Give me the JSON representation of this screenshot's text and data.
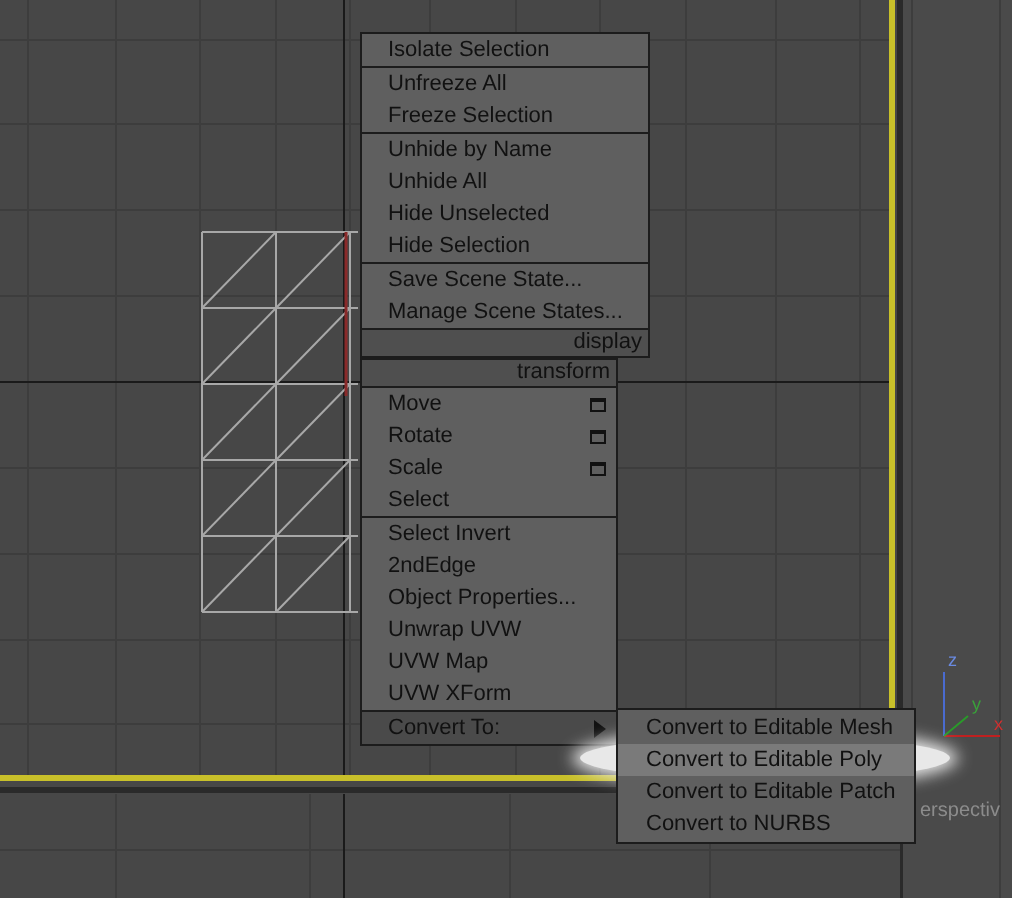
{
  "viewport": {
    "perspective_label": "erspectiv",
    "axis_labels": [
      "z",
      "y",
      "x"
    ]
  },
  "quad_menu": {
    "display": {
      "title": "display",
      "groups": [
        [
          {
            "label": "Isolate Selection",
            "selected": false,
            "options_box": false,
            "submenu": false
          }
        ],
        [
          {
            "label": "Unfreeze All",
            "selected": false,
            "options_box": false,
            "submenu": false
          },
          {
            "label": "Freeze Selection",
            "selected": false,
            "options_box": false,
            "submenu": false
          }
        ],
        [
          {
            "label": "Unhide by Name",
            "selected": false,
            "options_box": false,
            "submenu": false
          },
          {
            "label": "Unhide All",
            "selected": false,
            "options_box": false,
            "submenu": false
          },
          {
            "label": "Hide Unselected",
            "selected": false,
            "options_box": false,
            "submenu": false
          },
          {
            "label": "Hide Selection",
            "selected": false,
            "options_box": false,
            "submenu": false
          }
        ],
        [
          {
            "label": "Save Scene State...",
            "selected": false,
            "options_box": false,
            "submenu": false
          },
          {
            "label": "Manage Scene States...",
            "selected": false,
            "options_box": false,
            "submenu": false
          }
        ]
      ]
    },
    "transform": {
      "title": "transform",
      "groups": [
        [
          {
            "label": "Move",
            "selected": false,
            "options_box": true,
            "submenu": false
          },
          {
            "label": "Rotate",
            "selected": false,
            "options_box": true,
            "submenu": false
          },
          {
            "label": "Scale",
            "selected": false,
            "options_box": true,
            "submenu": false
          },
          {
            "label": "Select",
            "selected": false,
            "options_box": false,
            "submenu": false
          }
        ],
        [
          {
            "label": "Select Invert",
            "selected": false,
            "options_box": false,
            "submenu": false
          },
          {
            "label": "2ndEdge",
            "selected": false,
            "options_box": false,
            "submenu": false
          },
          {
            "label": "Object Properties...",
            "selected": false,
            "options_box": false,
            "submenu": false
          },
          {
            "label": "Unwrap UVW",
            "selected": false,
            "options_box": false,
            "submenu": false
          },
          {
            "label": "UVW Map",
            "selected": false,
            "options_box": false,
            "submenu": false
          },
          {
            "label": "UVW XForm",
            "selected": false,
            "options_box": false,
            "submenu": false
          }
        ],
        [
          {
            "label": "Convert To:",
            "selected": true,
            "options_box": false,
            "submenu": true
          }
        ]
      ]
    }
  },
  "submenu": {
    "items": [
      {
        "label": "Convert to Editable Mesh",
        "selected": false
      },
      {
        "label": "Convert to Editable Poly",
        "selected": true
      },
      {
        "label": "Convert to Editable Patch",
        "selected": false
      },
      {
        "label": "Convert to NURBS",
        "selected": false
      }
    ]
  }
}
